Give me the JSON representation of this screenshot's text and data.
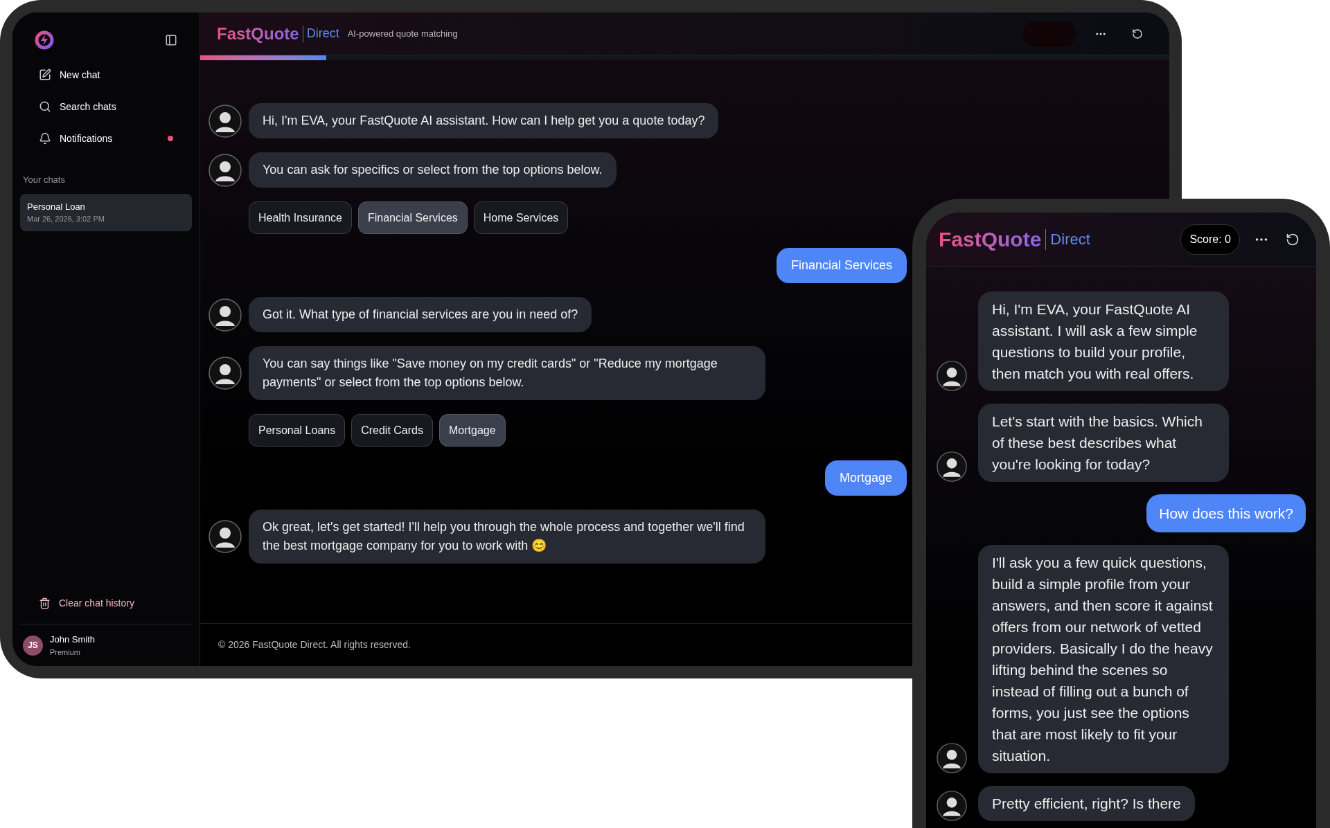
{
  "tablet": {
    "sidebar": {
      "nav": [
        {
          "label": "New chat",
          "badge": false
        },
        {
          "label": "Search chats",
          "badge": false
        },
        {
          "label": "Notifications",
          "badge": true
        }
      ],
      "section_title": "Your chats",
      "chats": [
        {
          "title": "Personal Loan",
          "date": "Mar 26, 2026, 3:02 PM",
          "selected": true
        }
      ],
      "clear": "Clear chat history",
      "user": {
        "initials": "JS",
        "name": "John Smith",
        "plan": "Premium"
      }
    },
    "header": {
      "brand": "FastQuote",
      "brand_suffix": "Direct",
      "tagline": "AI-powered quote matching"
    },
    "progress": {
      "level": 0.13
    },
    "messages": [
      {
        "kind": "bot",
        "text": "Hi, I'm EVA, your FastQuote AI assistant. How can I help get you a quote today?"
      },
      {
        "kind": "bot",
        "text": "You can ask for specifics or select from the top options below."
      },
      {
        "kind": "options",
        "options": [
          {
            "label": "Health Insurance",
            "selected": false
          },
          {
            "label": "Financial Services",
            "selected": true
          },
          {
            "label": "Home Services",
            "selected": false
          }
        ]
      },
      {
        "kind": "user",
        "text": "Financial Services"
      },
      {
        "kind": "bot",
        "text": "Got it. What type of financial services are you in need of?"
      },
      {
        "kind": "bot",
        "text": "You can say things like \"Save money on my credit cards\" or \"Reduce my mortgage payments\" or select from the top options below."
      },
      {
        "kind": "options",
        "options": [
          {
            "label": "Personal Loans",
            "selected": false
          },
          {
            "label": "Credit Cards",
            "selected": false
          },
          {
            "label": "Mortgage",
            "selected": true
          }
        ]
      },
      {
        "kind": "user",
        "text": "Mortgage"
      },
      {
        "kind": "bot",
        "text": "Ok great, let's get started! I'll help you through the whole process and together we'll find the best mortgage company for you to work with 😊"
      }
    ],
    "footer": "© 2026 FastQuote Direct. All rights reserved."
  },
  "phone": {
    "header": {
      "brand": "FastQuote",
      "brand_suffix": "Direct",
      "score": "Score: 0"
    },
    "messages": [
      {
        "kind": "bot",
        "text": "Hi, I'm EVA, your FastQuote AI assistant. I will ask a few simple questions to build your profile, then match you with real offers."
      },
      {
        "kind": "bot",
        "text": "Let's start with the basics. Which of these best describes what you're looking for today?"
      },
      {
        "kind": "user",
        "text": "How does this work?"
      },
      {
        "kind": "bot",
        "text": "I'll ask you a few quick questions, build a simple profile from your answers, and then score it against offers from our network of vetted providers. Basically I do the heavy lifting behind the scenes so instead of filling out a bunch of forms, you just see the options that are most likely to fit your situation."
      },
      {
        "kind": "bot",
        "text": "Pretty efficient, right? Is there"
      }
    ]
  }
}
